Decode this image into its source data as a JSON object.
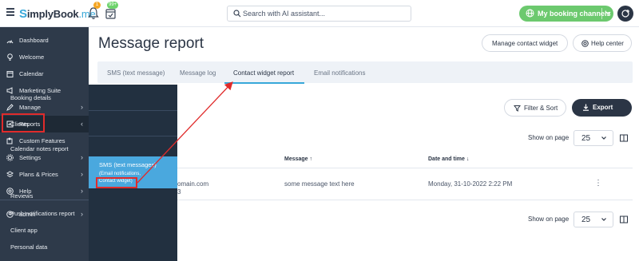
{
  "header": {
    "logo_text": "implyBook",
    "logo_s": "S",
    "logo_suffix": ".me",
    "notif_badge": "1",
    "cal_badge": "99+",
    "search_placeholder": "Search with AI assistant...",
    "channels_label": "My booking channels"
  },
  "sidebar": {
    "items": [
      {
        "label": "Dashboard",
        "icon": "dashboard-icon"
      },
      {
        "label": "Welcome",
        "icon": "lightbulb-icon"
      },
      {
        "label": "Calendar",
        "icon": "calendar-icon"
      },
      {
        "label": "Marketing Suite",
        "icon": "megaphone-icon"
      },
      {
        "label": "Manage",
        "icon": "pencil-icon"
      },
      {
        "label": "Reports",
        "icon": "chart-icon"
      },
      {
        "label": "Custom Features",
        "icon": "puzzle-icon"
      },
      {
        "label": "Settings",
        "icon": "gear-icon"
      },
      {
        "label": "Plans & Prices",
        "icon": "layers-icon"
      },
      {
        "label": "Help",
        "icon": "help-icon"
      },
      {
        "label": "admin",
        "icon": "user-icon"
      }
    ]
  },
  "submenu": {
    "items": [
      {
        "label": "Booking details"
      },
      {
        "label": "Clients"
      },
      {
        "label": "Calendar notes report"
      },
      {
        "label": "Reviews"
      },
      {
        "label": "Push notifications report"
      },
      {
        "label": "Client app"
      },
      {
        "label": "Personal data"
      }
    ],
    "sms": {
      "label": "SMS (text messages)",
      "sub1": "(Email notifications,",
      "sub2": "Contact widget)"
    }
  },
  "main": {
    "title": "Message report",
    "manage_widget": "Manage contact widget",
    "help_center": "Help center",
    "tabs": [
      {
        "label": "SMS (text message)"
      },
      {
        "label": "Message log"
      },
      {
        "label": "Contact widget report"
      },
      {
        "label": "Email notifications"
      }
    ],
    "filter_label": "Filter & Sort",
    "export_label": "Export",
    "show_on_page": "Show on page",
    "page_size": "25",
    "columns": {
      "message": "Message ↑",
      "datetime": "Date and time ↓"
    },
    "row": {
      "email_partial": "omain.com",
      "phone_partial": "3",
      "message": "some message text here",
      "datetime": "Monday, 31-10-2022 2:22 PM"
    }
  },
  "colors": {
    "sidebar": "#2e3a4a",
    "submenu": "#223040",
    "sms_highlight": "#4aa8de",
    "channels_green": "#6cc96e",
    "annotation_red": "#e02b2b"
  }
}
